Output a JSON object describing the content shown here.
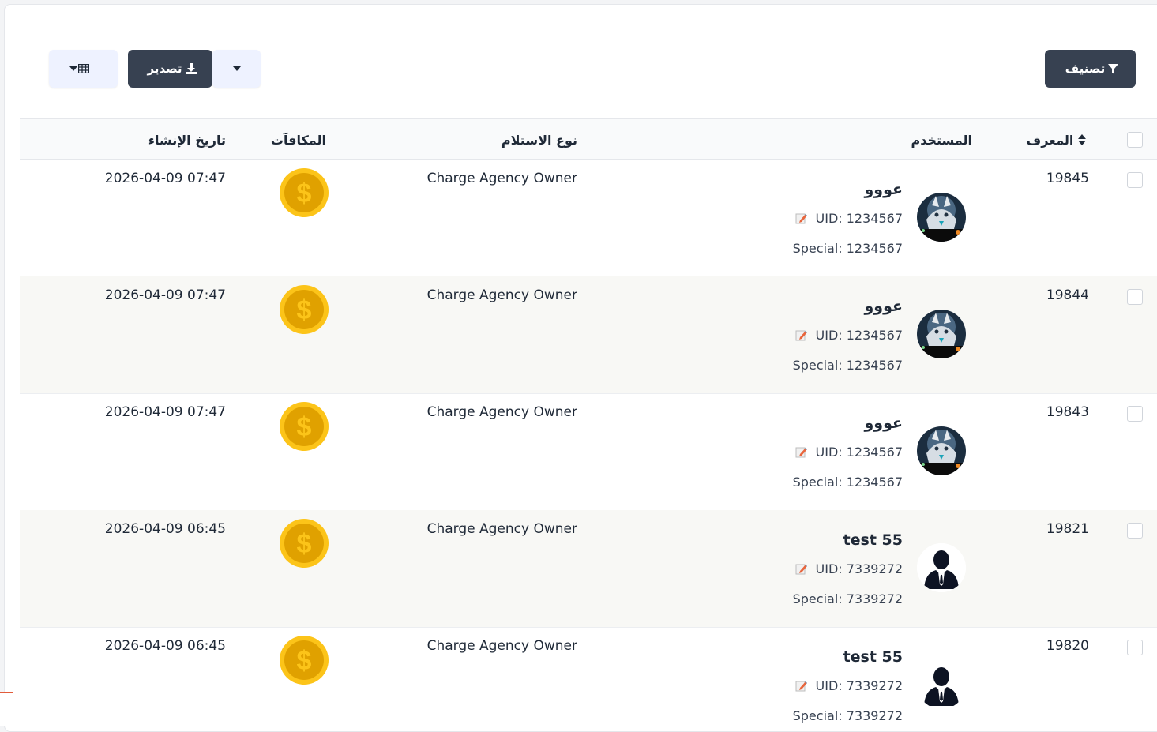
{
  "toolbar": {
    "filter_label": "تصنيف",
    "export_label": "تصدير"
  },
  "table": {
    "headers": {
      "id": "المعرف",
      "user": "المستخدم",
      "receive_type": "نوع الاستلام",
      "rewards": "المكافآت",
      "created_at": "تاريخ الإنشاء"
    },
    "rows": [
      {
        "id": "19845",
        "name": "عووو",
        "uid": "UID: 1234567",
        "special": "Special: 1234567",
        "type": "Charge Agency Owner",
        "date": "2026-04-09 07:47",
        "avatar": "wolf-avatar"
      },
      {
        "id": "19844",
        "name": "عووو",
        "uid": "UID: 1234567",
        "special": "Special: 1234567",
        "type": "Charge Agency Owner",
        "date": "2026-04-09 07:47",
        "avatar": "wolf-avatar"
      },
      {
        "id": "19843",
        "name": "عووو",
        "uid": "UID: 1234567",
        "special": "Special: 1234567",
        "type": "Charge Agency Owner",
        "date": "2026-04-09 07:47",
        "avatar": "wolf-avatar"
      },
      {
        "id": "19821",
        "name": "test 55",
        "uid": "UID: 7339272",
        "special": "Special: 7339272",
        "type": "Charge Agency Owner",
        "date": "2026-04-09 06:45",
        "avatar": "person-silhouette-avatar"
      },
      {
        "id": "19820",
        "name": "test 55",
        "uid": "UID: 7339272",
        "special": "Special: 7339272",
        "type": "Charge Agency Owner",
        "date": "2026-04-09 06:45",
        "avatar": "person-silhouette-avatar"
      }
    ]
  },
  "colors": {
    "dark_button": "#374151",
    "light_button": "#eef2ff",
    "coin_outer": "#fcc419",
    "coin_inner": "#e0a100",
    "alt_row": "#f8f8f5"
  }
}
